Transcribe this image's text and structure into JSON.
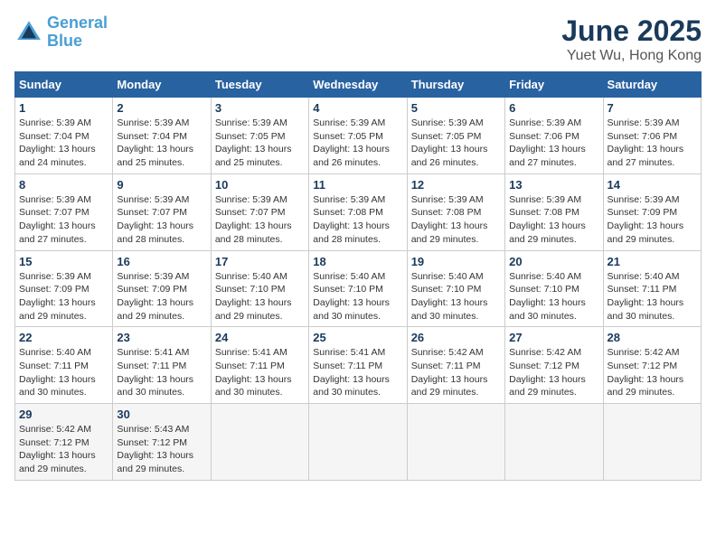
{
  "header": {
    "logo_line1": "General",
    "logo_line2": "Blue",
    "title": "June 2025",
    "subtitle": "Yuet Wu, Hong Kong"
  },
  "calendar": {
    "days_of_week": [
      "Sunday",
      "Monday",
      "Tuesday",
      "Wednesday",
      "Thursday",
      "Friday",
      "Saturday"
    ],
    "weeks": [
      [
        {
          "day": "",
          "info": ""
        },
        {
          "day": "2",
          "info": "Sunrise: 5:39 AM\nSunset: 7:04 PM\nDaylight: 13 hours\nand 25 minutes."
        },
        {
          "day": "3",
          "info": "Sunrise: 5:39 AM\nSunset: 7:05 PM\nDaylight: 13 hours\nand 25 minutes."
        },
        {
          "day": "4",
          "info": "Sunrise: 5:39 AM\nSunset: 7:05 PM\nDaylight: 13 hours\nand 26 minutes."
        },
        {
          "day": "5",
          "info": "Sunrise: 5:39 AM\nSunset: 7:05 PM\nDaylight: 13 hours\nand 26 minutes."
        },
        {
          "day": "6",
          "info": "Sunrise: 5:39 AM\nSunset: 7:06 PM\nDaylight: 13 hours\nand 27 minutes."
        },
        {
          "day": "7",
          "info": "Sunrise: 5:39 AM\nSunset: 7:06 PM\nDaylight: 13 hours\nand 27 minutes."
        }
      ],
      [
        {
          "day": "1",
          "info": "Sunrise: 5:39 AM\nSunset: 7:04 PM\nDaylight: 13 hours\nand 24 minutes."
        },
        {
          "day": "9",
          "info": "Sunrise: 5:39 AM\nSunset: 7:07 PM\nDaylight: 13 hours\nand 28 minutes."
        },
        {
          "day": "10",
          "info": "Sunrise: 5:39 AM\nSunset: 7:07 PM\nDaylight: 13 hours\nand 28 minutes."
        },
        {
          "day": "11",
          "info": "Sunrise: 5:39 AM\nSunset: 7:08 PM\nDaylight: 13 hours\nand 28 minutes."
        },
        {
          "day": "12",
          "info": "Sunrise: 5:39 AM\nSunset: 7:08 PM\nDaylight: 13 hours\nand 29 minutes."
        },
        {
          "day": "13",
          "info": "Sunrise: 5:39 AM\nSunset: 7:08 PM\nDaylight: 13 hours\nand 29 minutes."
        },
        {
          "day": "14",
          "info": "Sunrise: 5:39 AM\nSunset: 7:09 PM\nDaylight: 13 hours\nand 29 minutes."
        }
      ],
      [
        {
          "day": "8",
          "info": "Sunrise: 5:39 AM\nSunset: 7:07 PM\nDaylight: 13 hours\nand 27 minutes."
        },
        {
          "day": "16",
          "info": "Sunrise: 5:39 AM\nSunset: 7:09 PM\nDaylight: 13 hours\nand 29 minutes."
        },
        {
          "day": "17",
          "info": "Sunrise: 5:40 AM\nSunset: 7:10 PM\nDaylight: 13 hours\nand 29 minutes."
        },
        {
          "day": "18",
          "info": "Sunrise: 5:40 AM\nSunset: 7:10 PM\nDaylight: 13 hours\nand 30 minutes."
        },
        {
          "day": "19",
          "info": "Sunrise: 5:40 AM\nSunset: 7:10 PM\nDaylight: 13 hours\nand 30 minutes."
        },
        {
          "day": "20",
          "info": "Sunrise: 5:40 AM\nSunset: 7:10 PM\nDaylight: 13 hours\nand 30 minutes."
        },
        {
          "day": "21",
          "info": "Sunrise: 5:40 AM\nSunset: 7:11 PM\nDaylight: 13 hours\nand 30 minutes."
        }
      ],
      [
        {
          "day": "15",
          "info": "Sunrise: 5:39 AM\nSunset: 7:09 PM\nDaylight: 13 hours\nand 29 minutes."
        },
        {
          "day": "23",
          "info": "Sunrise: 5:41 AM\nSunset: 7:11 PM\nDaylight: 13 hours\nand 30 minutes."
        },
        {
          "day": "24",
          "info": "Sunrise: 5:41 AM\nSunset: 7:11 PM\nDaylight: 13 hours\nand 30 minutes."
        },
        {
          "day": "25",
          "info": "Sunrise: 5:41 AM\nSunset: 7:11 PM\nDaylight: 13 hours\nand 30 minutes."
        },
        {
          "day": "26",
          "info": "Sunrise: 5:42 AM\nSunset: 7:11 PM\nDaylight: 13 hours\nand 29 minutes."
        },
        {
          "day": "27",
          "info": "Sunrise: 5:42 AM\nSunset: 7:12 PM\nDaylight: 13 hours\nand 29 minutes."
        },
        {
          "day": "28",
          "info": "Sunrise: 5:42 AM\nSunset: 7:12 PM\nDaylight: 13 hours\nand 29 minutes."
        }
      ],
      [
        {
          "day": "22",
          "info": "Sunrise: 5:40 AM\nSunset: 7:11 PM\nDaylight: 13 hours\nand 30 minutes."
        },
        {
          "day": "30",
          "info": "Sunrise: 5:43 AM\nSunset: 7:12 PM\nDaylight: 13 hours\nand 29 minutes."
        },
        {
          "day": "",
          "info": ""
        },
        {
          "day": "",
          "info": ""
        },
        {
          "day": "",
          "info": ""
        },
        {
          "day": "",
          "info": ""
        },
        {
          "day": ""
        }
      ],
      [
        {
          "day": "29",
          "info": "Sunrise: 5:42 AM\nSunset: 7:12 PM\nDaylight: 13 hours\nand 29 minutes."
        },
        {
          "day": "",
          "info": ""
        },
        {
          "day": "",
          "info": ""
        },
        {
          "day": "",
          "info": ""
        },
        {
          "day": "",
          "info": ""
        },
        {
          "day": "",
          "info": ""
        },
        {
          "day": "",
          "info": ""
        }
      ]
    ]
  }
}
